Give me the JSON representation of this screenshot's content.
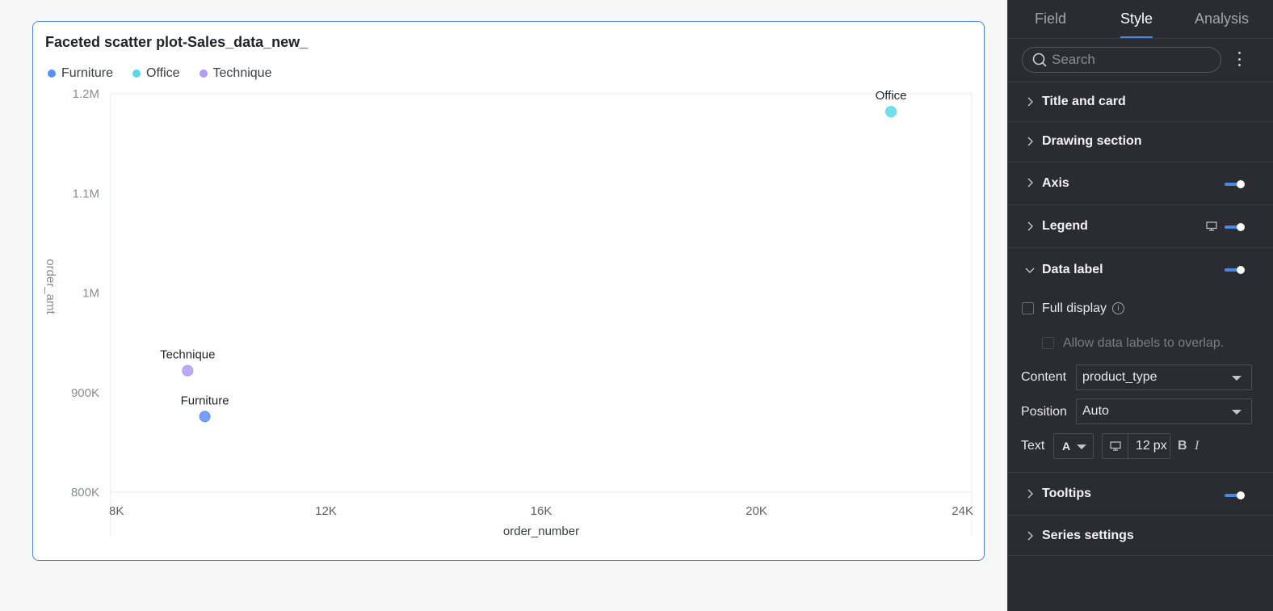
{
  "card": {
    "title": "Faceted scatter plot-Sales_data_new_"
  },
  "chart_data": {
    "type": "scatter",
    "title": "Faceted scatter plot-Sales_data_new_",
    "xlabel": "order_number",
    "ylabel": "order_amt",
    "xlim": [
      8000,
      24000
    ],
    "ylim": [
      800000,
      1200000
    ],
    "x_ticks": [
      {
        "v": 8000,
        "t": "8K"
      },
      {
        "v": 12000,
        "t": "12K"
      },
      {
        "v": 16000,
        "t": "16K"
      },
      {
        "v": 20000,
        "t": "20K"
      },
      {
        "v": 24000,
        "t": "24K"
      }
    ],
    "y_ticks": [
      {
        "v": 800000,
        "t": "800K"
      },
      {
        "v": 900000,
        "t": "900K"
      },
      {
        "v": 1000000,
        "t": "1M"
      },
      {
        "v": 1100000,
        "t": "1.1M"
      },
      {
        "v": 1200000,
        "t": "1.2M"
      }
    ],
    "series": [
      {
        "name": "Furniture",
        "color": "#5b8ff9",
        "points": [
          {
            "x": 9750,
            "y": 876000
          }
        ]
      },
      {
        "name": "Office",
        "color": "#5ad8e6",
        "points": [
          {
            "x": 22500,
            "y": 1182000
          }
        ]
      },
      {
        "name": "Technique",
        "color": "#b09bf5",
        "points": [
          {
            "x": 9430,
            "y": 922000
          }
        ]
      }
    ],
    "legend_position": "top-left",
    "grid": false
  },
  "panel": {
    "tabs": [
      "Field",
      "Style",
      "Analysis"
    ],
    "active_tab": "Style",
    "accent": "#4a86e8",
    "search_placeholder": "Search",
    "sections": {
      "title_card": "Title and card",
      "drawing": "Drawing section",
      "axis": "Axis",
      "legend": "Legend",
      "data_label": "Data label",
      "tooltips": "Tooltips",
      "series": "Series settings"
    },
    "data_label": {
      "full_display": "Full display",
      "allow_overlap": "Allow data labels to overlap.",
      "content_label": "Content",
      "content_value": "product_type",
      "position_label": "Position",
      "position_value": "Auto",
      "text_label": "Text",
      "font_color_glyph": "A",
      "font_size_value": "12",
      "font_size_unit": "px",
      "bold_glyph": "B",
      "italic_glyph": "I"
    }
  }
}
